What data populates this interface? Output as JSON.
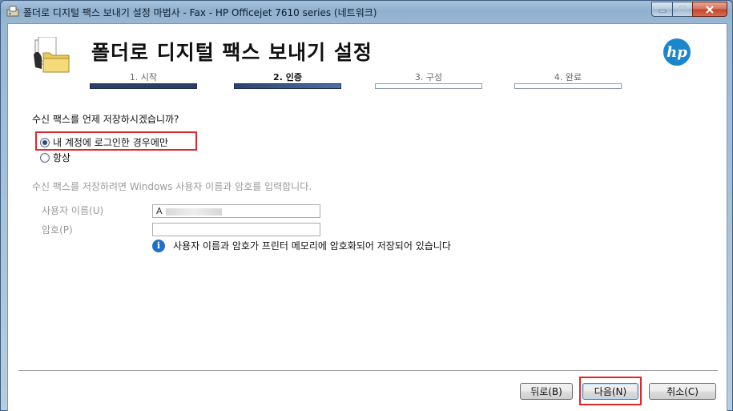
{
  "window": {
    "title": "폴더로 디지털 팩스 보내기 설정 마법사 - Fax - HP Officejet 7610 series (네트워크)"
  },
  "header": {
    "title": "폴더로 디지털 팩스 보내기 설정",
    "logo_text": "hp",
    "icon": "folder-fax-icon"
  },
  "steps": [
    {
      "label": "1. 시작",
      "state": "done"
    },
    {
      "label": "2. 인증",
      "state": "active"
    },
    {
      "label": "3. 구성",
      "state": "pending"
    },
    {
      "label": "4. 완료",
      "state": "pending"
    }
  ],
  "question": "수신 팩스를 언제 저장하시겠습니까?",
  "options": [
    {
      "label": "내 계정에 로그인한 경우에만",
      "selected": true
    },
    {
      "label": "항상",
      "selected": false
    }
  ],
  "hint": "수신 팩스를 저장하려면 Windows 사용자 이름과 암호를 입력합니다.",
  "fields": {
    "username_label": "사용자 이름(U)",
    "username_value": "A",
    "password_label": "암호(P)",
    "password_value": ""
  },
  "info_text": "사용자 이름과 암호가 프린터 메모리에 암호화되어 저장되어 있습니다",
  "buttons": {
    "back": "뒤로(B)",
    "next": "다음(N)",
    "cancel": "취소(C)"
  },
  "colors": {
    "highlight": "#e1262d",
    "step_done": "#2a3f67",
    "hp_blue": "#1a86cd"
  }
}
